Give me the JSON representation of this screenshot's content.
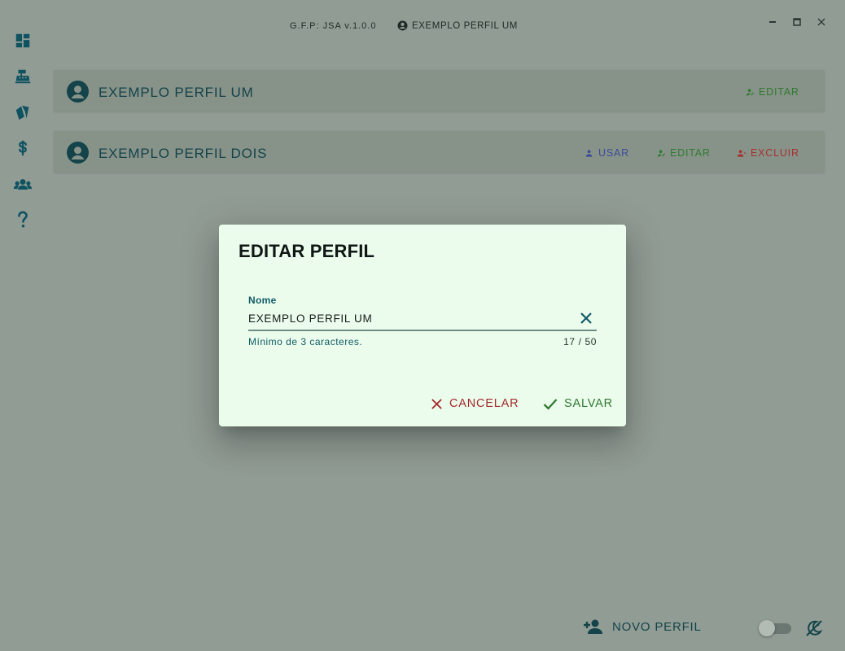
{
  "window": {
    "app_title": "G.F.P: JSA v.1.0.0",
    "current_profile": "EXEMPLO PERFIL UM",
    "controls": {
      "minimize_icon": "minimize-icon",
      "maximize_icon": "maximize-icon",
      "close_icon": "close-icon"
    }
  },
  "sidebar": {
    "items": [
      {
        "icon": "dashboard-icon"
      },
      {
        "icon": "cash-register-icon"
      },
      {
        "icon": "cards-icon"
      },
      {
        "icon": "dollar-icon"
      },
      {
        "icon": "users-icon"
      },
      {
        "icon": "help-icon"
      }
    ]
  },
  "profiles": [
    {
      "name": "EXEMPLO PERFIL UM",
      "actions": {
        "edit": "EDITAR"
      }
    },
    {
      "name": "EXEMPLO PERFIL DOIS",
      "actions": {
        "use": "USAR",
        "edit": "EDITAR",
        "delete": "EXCLUIR"
      }
    }
  ],
  "dialog": {
    "title": "EDITAR PERFIL",
    "field": {
      "label": "Nome",
      "value": "EXEMPLO PERFIL UM",
      "hint": "Mínimo de 3 caracteres.",
      "counter": "17 / 50"
    },
    "cancel_label": "CANCELAR",
    "save_label": "SALVAR"
  },
  "footer": {
    "new_profile_label": "NOVO PERFIL",
    "theme_toggle": {
      "on": false
    }
  },
  "colors": {
    "accent": "#0f5260",
    "cancel": "#a42b2c",
    "save": "#2f7a30",
    "use": "#3d4a9a",
    "dialog_bg": "#ebfcec"
  }
}
